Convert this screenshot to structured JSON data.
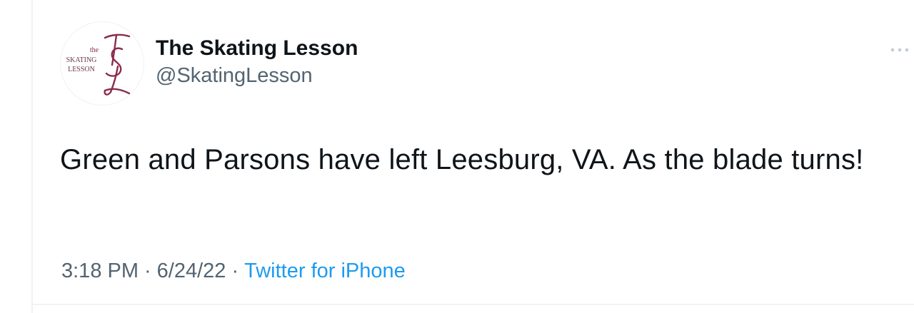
{
  "author": {
    "display_name": "The Skating Lesson",
    "handle": "@SkatingLesson",
    "avatar": {
      "line1": "the",
      "line2": "SKATING",
      "line3": "LESSON",
      "monogram_color": "#8b2c4e"
    }
  },
  "tweet": {
    "text": "Green and Parsons have left Leesburg, VA. As the blade turns!"
  },
  "meta": {
    "time": "3:18 PM",
    "separator": "·",
    "date": "6/24/22",
    "source": "Twitter for iPhone"
  },
  "colors": {
    "text_primary": "#0f1419",
    "text_secondary": "#536471",
    "link": "#1d9bf0",
    "divider": "#eff3f4"
  },
  "icons": {
    "more": "more-horizontal-icon"
  }
}
